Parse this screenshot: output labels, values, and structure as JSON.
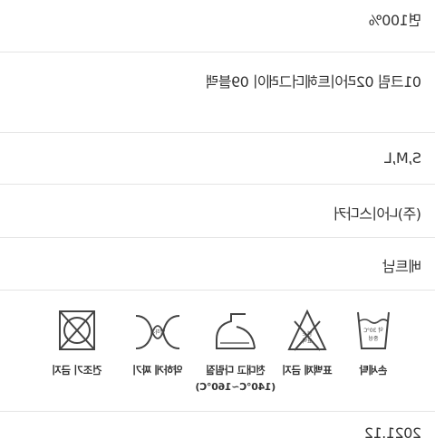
{
  "spec": {
    "material": "면100%",
    "color": "01크림 02라이트헤더그레이 09블랙",
    "size": "S,M,L",
    "maker": "(주)나이스다커",
    "country": "베트남",
    "date": "2021.12"
  },
  "care": {
    "items": [
      {
        "icon": "hand-wash-icon",
        "label": "손세탁",
        "icon_text": [
          "약 30℃",
          "중성"
        ]
      },
      {
        "icon": "no-bleach-icon",
        "label": "표백제 금지",
        "icon_text": [
          "염소",
          "표백"
        ]
      },
      {
        "icon": "iron-icon",
        "label": "천대고 다림질",
        "sub": "(140℃~160℃)"
      },
      {
        "icon": "dry-clean-icon",
        "label": "약하게 짜기",
        "icon_text": [
          "약하게"
        ]
      },
      {
        "icon": "no-tumble-dry-icon",
        "label": "건조기 금지"
      }
    ]
  }
}
